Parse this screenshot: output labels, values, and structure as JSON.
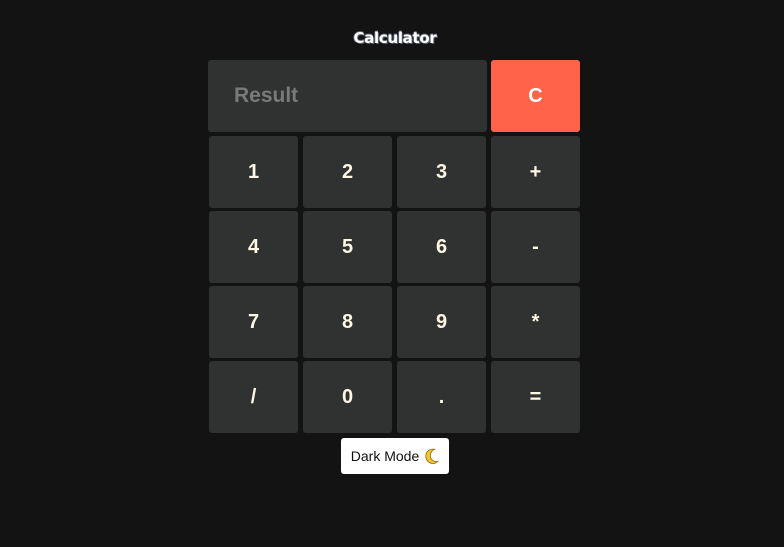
{
  "app": {
    "title": "Calculator"
  },
  "display": {
    "placeholder": "Result",
    "value": ""
  },
  "clear_label": "C",
  "keys": [
    {
      "label": "1",
      "icon": "digit"
    },
    {
      "label": "2",
      "icon": "digit"
    },
    {
      "label": "3",
      "icon": "digit"
    },
    {
      "label": "+",
      "icon": "plus"
    },
    {
      "label": "4",
      "icon": "digit"
    },
    {
      "label": "5",
      "icon": "digit"
    },
    {
      "label": "6",
      "icon": "digit"
    },
    {
      "label": "-",
      "icon": "minus"
    },
    {
      "label": "7",
      "icon": "digit"
    },
    {
      "label": "8",
      "icon": "digit"
    },
    {
      "label": "9",
      "icon": "digit"
    },
    {
      "label": "*",
      "icon": "multiply"
    },
    {
      "label": "/",
      "icon": "divide"
    },
    {
      "label": "0",
      "icon": "digit"
    },
    {
      "label": ".",
      "icon": "decimal"
    },
    {
      "label": "=",
      "icon": "equals"
    }
  ],
  "mode_toggle": {
    "label": "Dark Mode",
    "icon": "crescent-moon-icon"
  },
  "colors": {
    "background": "#131313",
    "key": "#2f3231",
    "clear": "#ff634a",
    "key_text": "#fff6e4"
  }
}
